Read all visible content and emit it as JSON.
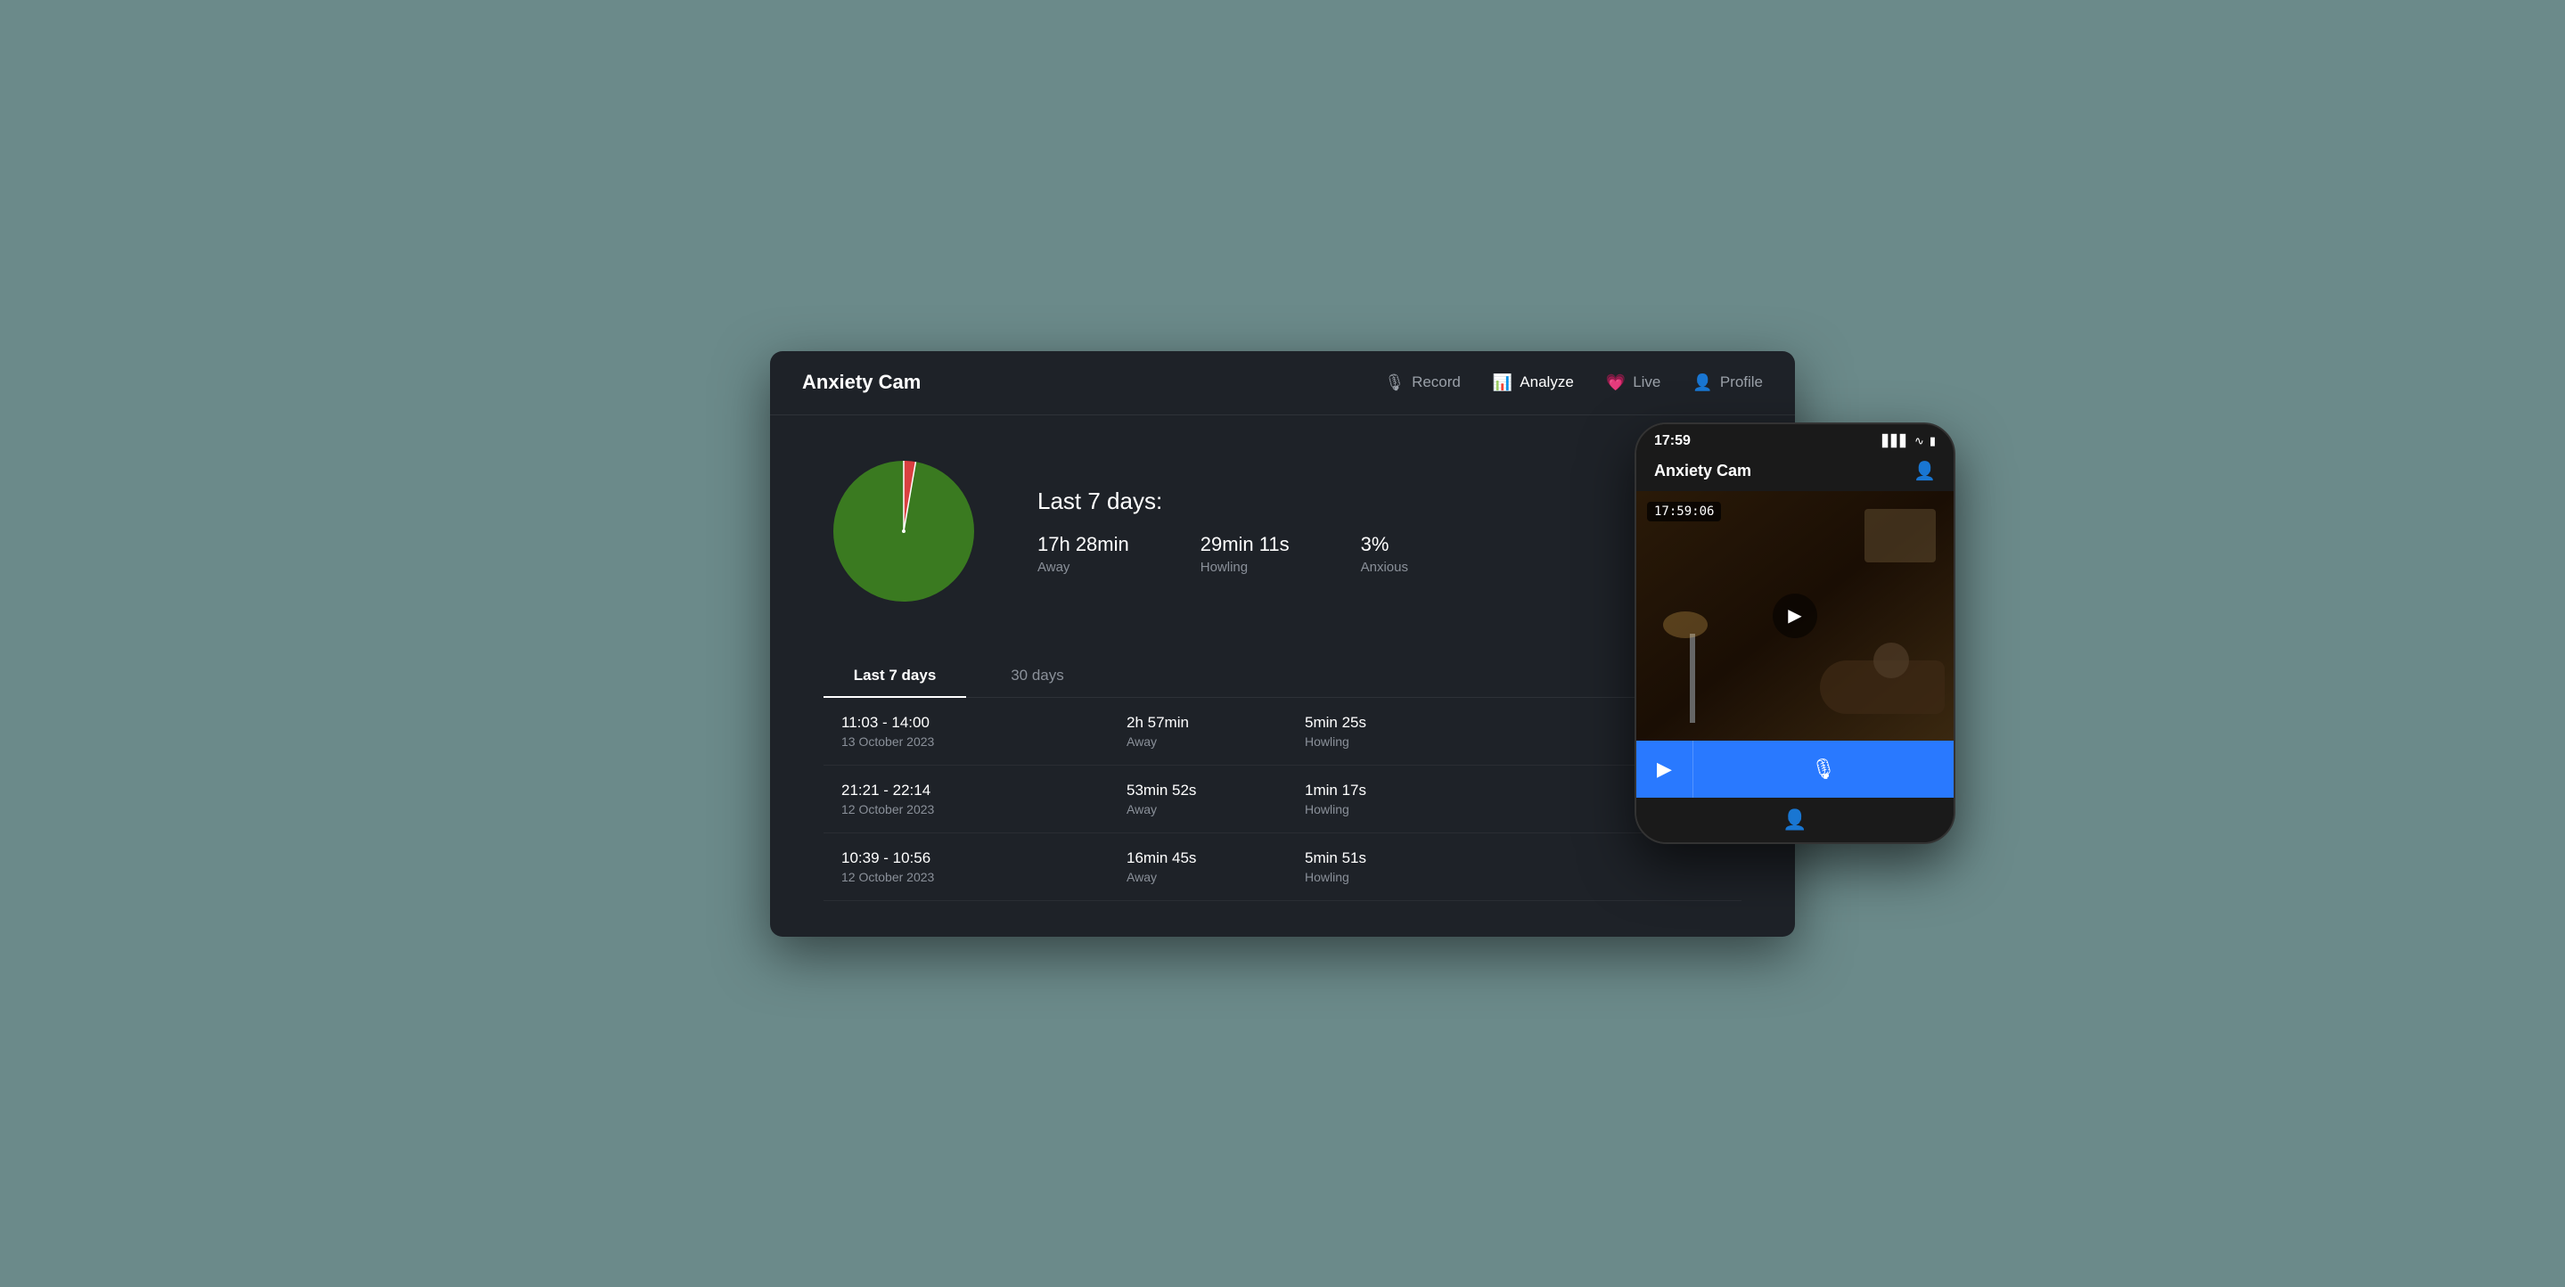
{
  "app": {
    "title": "Anxiety Cam",
    "background_color": "#1e2228"
  },
  "nav": {
    "items": [
      {
        "id": "record",
        "label": "Record",
        "icon": "🎙",
        "active": false
      },
      {
        "id": "analyze",
        "label": "Analyze",
        "icon": "📊",
        "active": true
      },
      {
        "id": "live",
        "label": "Live",
        "icon": "💗",
        "active": false
      },
      {
        "id": "profile",
        "label": "Profile",
        "icon": "👤",
        "active": false
      }
    ]
  },
  "summary": {
    "title": "Last 7 days:",
    "stats": [
      {
        "value": "17h 28min",
        "label": "Away"
      },
      {
        "value": "29min 11s",
        "label": "Howling"
      },
      {
        "value": "3%",
        "label": "Anxious"
      }
    ]
  },
  "tabs": [
    {
      "id": "last7days",
      "label": "Last 7 days",
      "active": true
    },
    {
      "id": "30days",
      "label": "30 days",
      "active": false
    }
  ],
  "table": {
    "rows": [
      {
        "time_range": "11:03 - 14:00",
        "date": "13 October 2023",
        "away_value": "2h 57min",
        "away_label": "Away",
        "howling_value": "5min 25s",
        "howling_label": "Howling"
      },
      {
        "time_range": "21:21 - 22:14",
        "date": "12 October 2023",
        "away_value": "53min 52s",
        "away_label": "Away",
        "howling_value": "1min 17s",
        "howling_label": "Howling"
      },
      {
        "time_range": "10:39 - 10:56",
        "date": "12 October 2023",
        "away_value": "16min 45s",
        "away_label": "Away",
        "howling_value": "5min 51s",
        "howling_label": "Howling"
      }
    ]
  },
  "phone": {
    "time": "17:59",
    "app_title": "Anxiety Cam",
    "video_timestamp": "17:59:06",
    "signal_bars": "▋▋▋▋",
    "wifi": "WiFi",
    "battery": "🔋"
  },
  "pie_chart": {
    "green_percent": 97,
    "red_percent": 3,
    "green_color": "#3a7a20",
    "red_color": "#d94040"
  }
}
